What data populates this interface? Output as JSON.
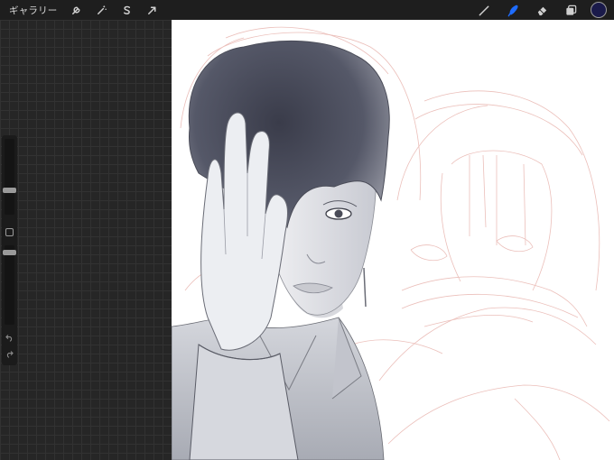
{
  "toolbar": {
    "gallery_label": "ギャラリー",
    "left_icons": [
      "wrench-icon",
      "magic-wand-icon",
      "selection-s-icon",
      "arrow-cursor-icon"
    ],
    "right_icons": [
      "brush-icon",
      "smudge-icon",
      "eraser-icon",
      "layers-icon"
    ],
    "active_tool": "smudge",
    "accent_color": "#1e6cff",
    "current_color": "#1a1a4a"
  },
  "sidebar": {
    "brush_size_level": 0.7,
    "opacity_level": 0.85,
    "buttons": [
      "modify-square-icon",
      "undo-icon",
      "redo-icon"
    ]
  }
}
